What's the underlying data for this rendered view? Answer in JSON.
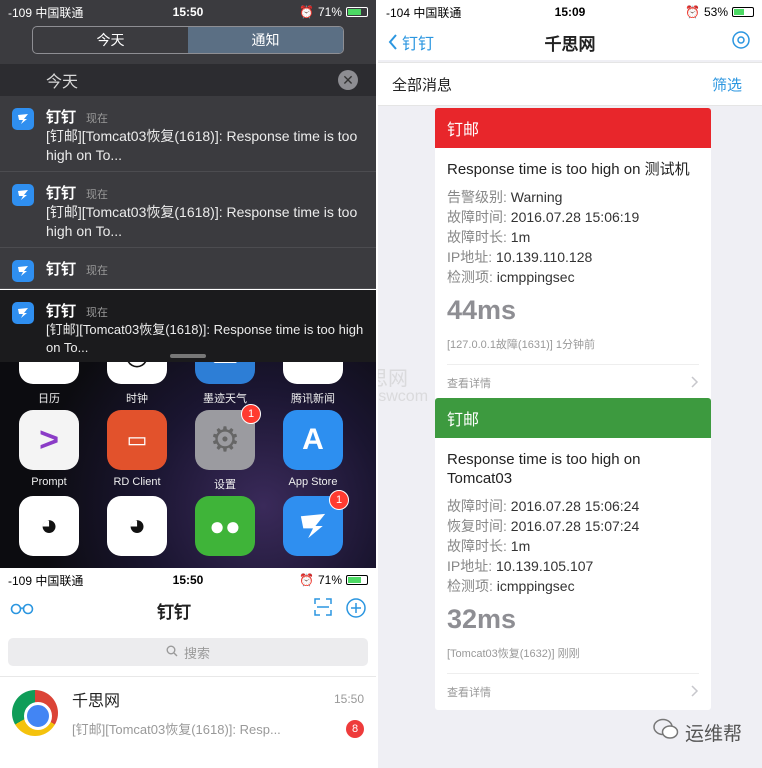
{
  "panel_a": {
    "status": {
      "carrier": "-109 中国联通",
      "time": "15:50",
      "battery": "71%"
    },
    "segments": [
      "今天",
      "通知"
    ],
    "header": "今天",
    "notifications": [
      {
        "app": "钉钉",
        "when": "现在",
        "body": "[钉邮][Tomcat03恢复(1618)]: Response time is too high on To..."
      },
      {
        "app": "钉钉",
        "when": "现在",
        "body": "[钉邮][Tomcat03恢复(1618)]: Response time is too high on To..."
      },
      {
        "app": "钉钉",
        "when": "现在",
        "body": ""
      }
    ]
  },
  "panel_b": {
    "banner": {
      "app": "钉钉",
      "when": "现在",
      "body": "[钉邮][Tomcat03恢复(1618)]: Response time is too high on To..."
    },
    "apps": [
      {
        "label": "日历",
        "icon": "calendar-icon"
      },
      {
        "label": "时钟",
        "icon": "clock-icon"
      },
      {
        "label": "墨迹天气",
        "icon": "weather-icon"
      },
      {
        "label": "腾讯新闻",
        "icon": "news-icon"
      },
      {
        "label": "Prompt",
        "icon": "prompt-icon"
      },
      {
        "label": "RD Client",
        "icon": "rdclient-icon"
      },
      {
        "label": "设置",
        "icon": "settings-icon",
        "badge": "1"
      },
      {
        "label": "App Store",
        "icon": "appstore-icon"
      },
      {
        "label": "",
        "icon": "qq-icon"
      },
      {
        "label": "",
        "icon": "qq-hd-icon"
      },
      {
        "label": "",
        "icon": "wechat-icon"
      },
      {
        "label": "",
        "icon": "dingtalk-icon",
        "badge": "1"
      }
    ]
  },
  "panel_c": {
    "status": {
      "carrier": "-109 中国联通",
      "time": "15:50",
      "battery": "71%"
    },
    "title": "钉钉",
    "search_placeholder": "搜索",
    "chat": {
      "name": "千思网",
      "time": "15:50",
      "preview": "[钉邮][Tomcat03恢复(1618)]: Resp...",
      "unread": "8"
    }
  },
  "panel_d": {
    "status": {
      "carrier": "-104 中国联通",
      "time": "15:09",
      "battery": "53%"
    },
    "back_label": "钉钉",
    "title": "千思网",
    "filter_left": "全部消息",
    "filter_right": "筛选",
    "cards": [
      {
        "header": "钉邮",
        "color": "#e8262b",
        "title": "Response time is too high on 测试机",
        "rows": [
          {
            "k": "告警级别:",
            "v": "Warning"
          },
          {
            "k": "故障时间:",
            "v": "2016.07.28 15:06:19"
          },
          {
            "k": "故障时长:",
            "v": "1m"
          },
          {
            "k": "IP地址:",
            "v": "10.139.110.128"
          },
          {
            "k": "检测项:",
            "v": "icmppingsec"
          }
        ],
        "big": "44ms",
        "footer": "[127.0.0.1故障(1631)] 1分钟前",
        "detail": "查看详情"
      },
      {
        "header": "钉邮",
        "color": "#3d9a3f",
        "title": "Response time is too high on Tomcat03",
        "rows": [
          {
            "k": "故障时间:",
            "v": "2016.07.28 15:06:24"
          },
          {
            "k": "恢复时间:",
            "v": "2016.07.28 15:07:24"
          },
          {
            "k": "故障时长:",
            "v": "1m"
          },
          {
            "k": "IP地址:",
            "v": "10.139.105.107"
          },
          {
            "k": "检测项:",
            "v": "icmppingsec"
          }
        ],
        "big": "32ms",
        "footer": "[Tomcat03恢复(1632)] 刚刚",
        "detail": "查看详情"
      }
    ]
  },
  "watermarks": {
    "site_cn": "千思网",
    "site_url": "qianswcom",
    "footer": "运维帮"
  }
}
